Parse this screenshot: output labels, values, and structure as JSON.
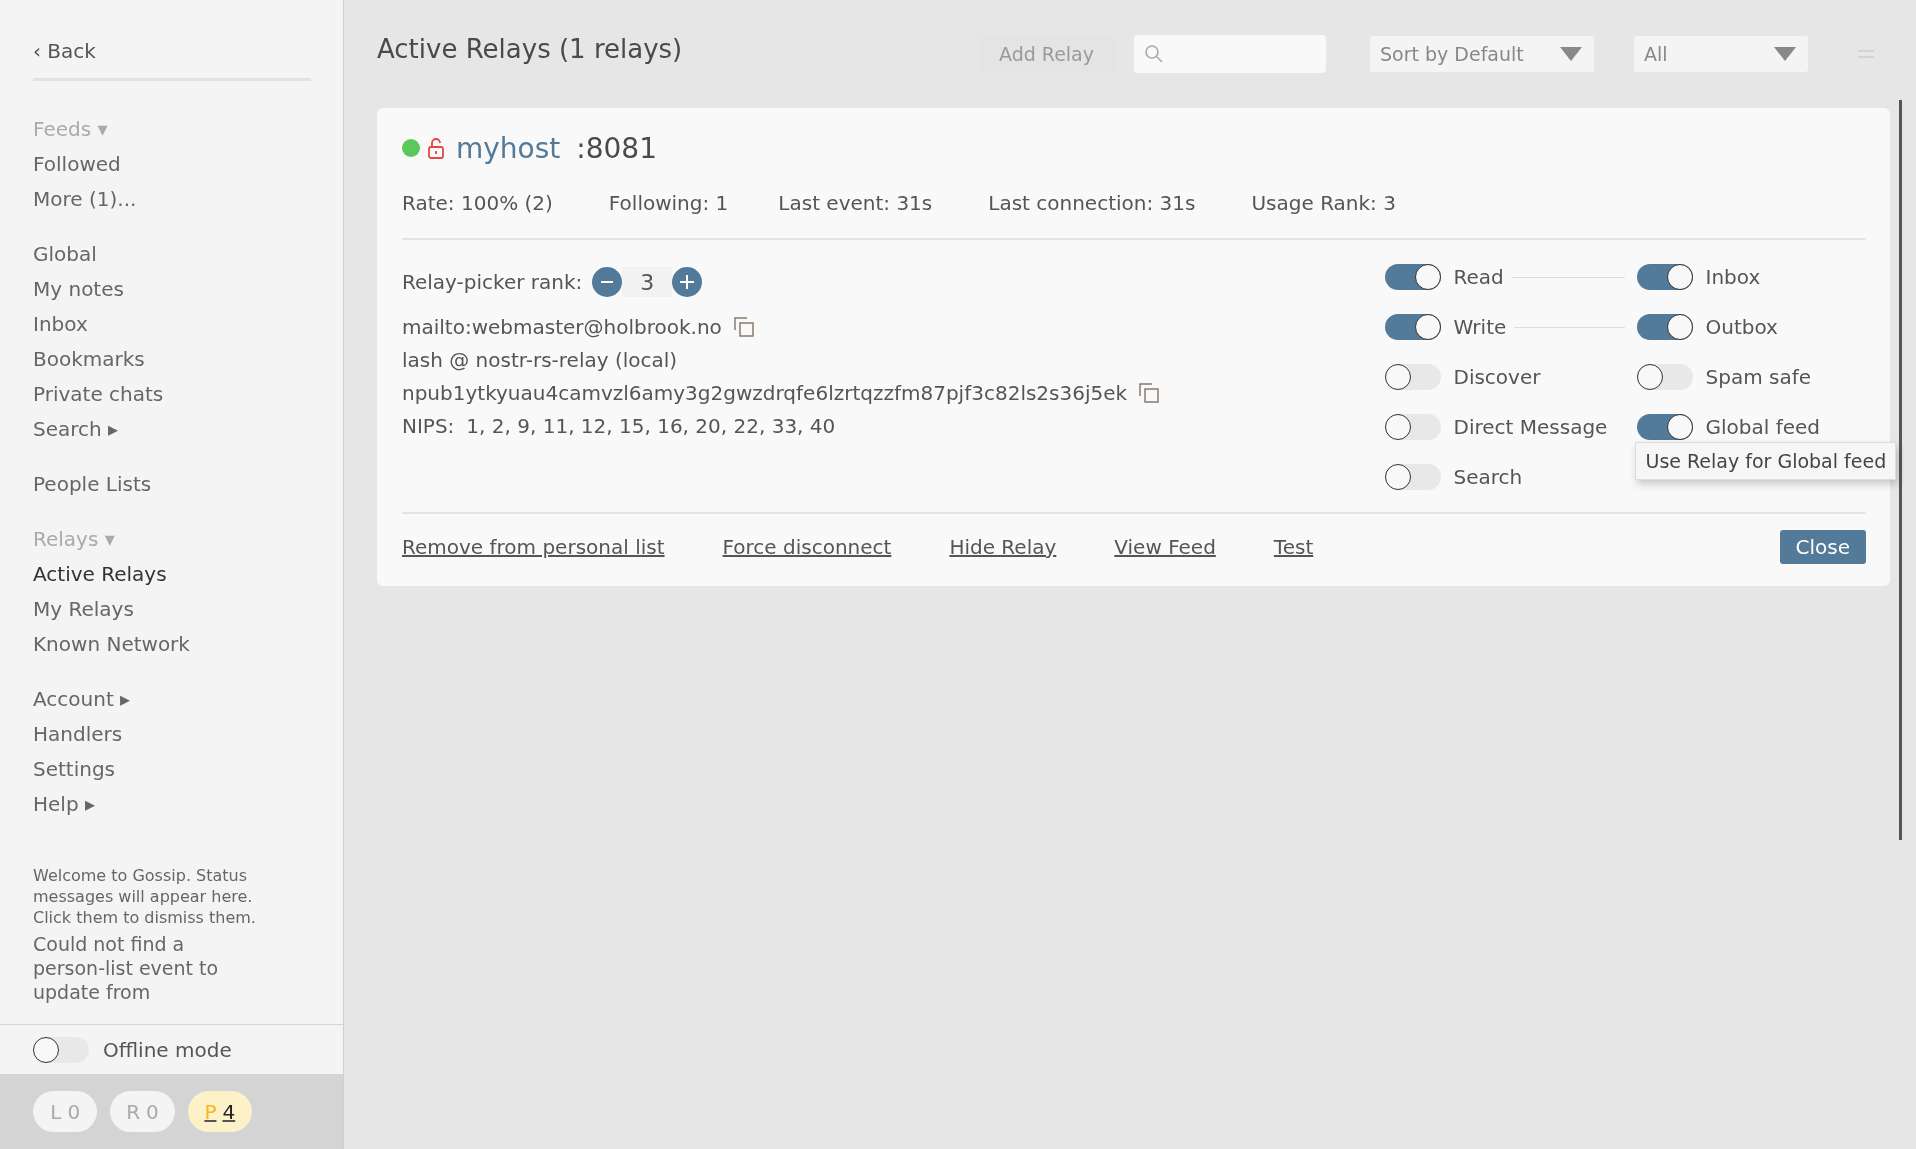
{
  "sidebar": {
    "back": "‹ Back",
    "groups": [
      {
        "heading": "Feeds ▾",
        "items": [
          {
            "label": "Followed",
            "selected": false
          },
          {
            "label": "More (1)...",
            "selected": false
          }
        ]
      },
      {
        "items": [
          {
            "label": "Global",
            "selected": false
          },
          {
            "label": "My notes",
            "selected": false
          },
          {
            "label": "Inbox",
            "selected": false
          },
          {
            "label": "Bookmarks",
            "selected": false
          },
          {
            "label": "Private chats",
            "selected": false
          },
          {
            "label": "Search ▸",
            "selected": false
          }
        ]
      },
      {
        "items": [
          {
            "label": "People Lists",
            "selected": false
          }
        ]
      },
      {
        "heading": "Relays ▾",
        "items": [
          {
            "label": "Active Relays",
            "selected": true
          },
          {
            "label": "My Relays",
            "selected": false
          },
          {
            "label": "Known Network",
            "selected": false
          }
        ]
      },
      {
        "items": [
          {
            "label": "Account ▸",
            "selected": false
          },
          {
            "label": "Handlers",
            "selected": false
          },
          {
            "label": "Settings",
            "selected": false
          },
          {
            "label": "Help ▸",
            "selected": false
          }
        ]
      }
    ],
    "status_messages": [
      {
        "kind": "info",
        "text": "Welcome to Gossip. Status messages will appear here. Click them to dismiss them."
      },
      {
        "kind": "result",
        "text": "Could not find a person-list event to update from"
      }
    ],
    "offline_mode": {
      "label": "Offline mode",
      "on": false
    },
    "counters": [
      {
        "letter": "L",
        "count": "0",
        "active": false
      },
      {
        "letter": "R",
        "count": "0",
        "active": false
      },
      {
        "letter": "P",
        "count": "4",
        "active": true
      }
    ]
  },
  "header": {
    "title": "Active Relays (1 relays)",
    "add_relay": {
      "label": "Add Relay",
      "disabled": true
    },
    "sort": "Sort by Default",
    "filter": "All"
  },
  "relay": {
    "connected": true,
    "host": "myhost",
    "port": ":8081",
    "stats": [
      "Rate: 100% (2)",
      "Following: 1",
      "Last event: 31s",
      "Last connection: 31s",
      "Usage Rank: 3"
    ],
    "rank": {
      "label": "Relay-picker rank:",
      "value": "3"
    },
    "contact": "mailto:webmaster@holbrook.no",
    "software": "lash @ nostr-rs-relay (local)",
    "pubkey": "npub1ytkyuau4camvzl6amy3g2gwzdrqfe6lzrtqzzfm87pjf3c82ls2s36j5ek",
    "nips": {
      "label": "NIPS:",
      "value": "1, 2, 9, 11, 12, 15, 16, 20, 22, 33, 40"
    },
    "toggle_rows": [
      {
        "linked": true,
        "left": {
          "label": "Read",
          "on": true
        },
        "right": {
          "label": "Inbox",
          "on": true
        }
      },
      {
        "linked": true,
        "left": {
          "label": "Write",
          "on": true
        },
        "right": {
          "label": "Outbox",
          "on": true
        }
      },
      {
        "linked": false,
        "left": {
          "label": "Discover",
          "on": false
        },
        "right": {
          "label": "Spam safe",
          "on": false
        }
      },
      {
        "linked": false,
        "left": {
          "label": "Direct Message",
          "on": false
        },
        "right": {
          "label": "Global feed",
          "on": true,
          "tooltip": "Use Relay for Global feed"
        }
      },
      {
        "linked": false,
        "left": {
          "label": "Search",
          "on": false
        }
      }
    ],
    "actions": [
      "Remove from personal list",
      "Force disconnect",
      "Hide Relay",
      "View Feed",
      "Test"
    ],
    "close": "Close"
  }
}
